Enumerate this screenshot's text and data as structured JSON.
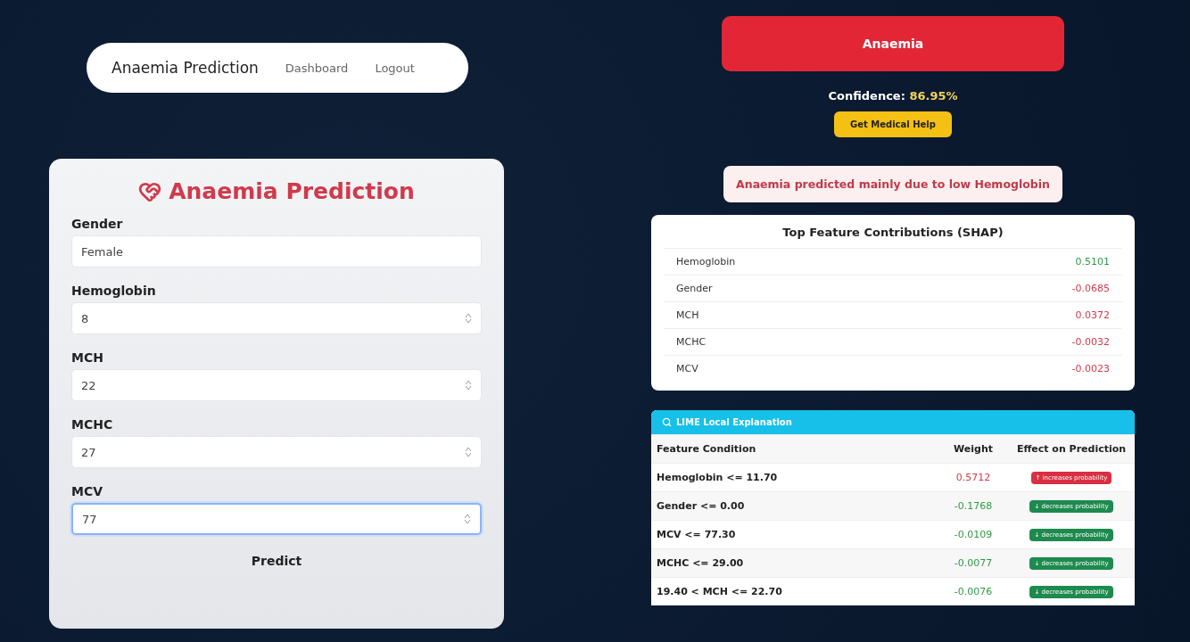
{
  "navbar": {
    "brand": "Anaemia Prediction",
    "links": [
      "Dashboard",
      "Logout"
    ]
  },
  "form": {
    "title": "Anaemia Prediction",
    "fields": [
      {
        "label": "Gender",
        "value": "Female",
        "kind": "text",
        "focused": false
      },
      {
        "label": "Hemoglobin",
        "value": "8",
        "kind": "number",
        "focused": false
      },
      {
        "label": "MCH",
        "value": "22",
        "kind": "number",
        "focused": false
      },
      {
        "label": "MCHC",
        "value": "27",
        "kind": "number",
        "focused": false
      },
      {
        "label": "MCV",
        "value": "77",
        "kind": "number",
        "focused": true
      }
    ],
    "submit": "Predict"
  },
  "result": {
    "label": "Anaemia",
    "confidence_label": "Confidence:",
    "confidence_value": "86.95%",
    "help_button": "Get Medical Help",
    "reason": "Anaemia predicted mainly due to low Hemoglobin"
  },
  "shap": {
    "title": "Top Feature Contributions (SHAP)",
    "rows": [
      {
        "feature": "Hemoglobin",
        "value": "0.5101",
        "kind": "positive"
      },
      {
        "feature": "Gender",
        "value": "-0.0685",
        "kind": "negative"
      },
      {
        "feature": "MCH",
        "value": "0.0372",
        "kind": "negative"
      },
      {
        "feature": "MCHC",
        "value": "-0.0032",
        "kind": "negative"
      },
      {
        "feature": "MCV",
        "value": "-0.0023",
        "kind": "negative"
      }
    ]
  },
  "lime": {
    "title": "LIME Local Explanation",
    "columns": [
      "Feature Condition",
      "Weight",
      "Effect on Prediction"
    ],
    "rows": [
      {
        "condition": "Hemoglobin <= 11.70",
        "weight": "0.5712",
        "effect": "↑ increases probability",
        "kind": "increase"
      },
      {
        "condition": "Gender <= 0.00",
        "weight": "-0.1768",
        "effect": "↓ decreases probability",
        "kind": "decrease"
      },
      {
        "condition": "MCV <= 77.30",
        "weight": "-0.0109",
        "effect": "↓ decreases probability",
        "kind": "decrease"
      },
      {
        "condition": "MCHC <= 29.00",
        "weight": "-0.0077",
        "effect": "↓ decreases probability",
        "kind": "decrease"
      },
      {
        "condition": "19.40 < MCH <= 22.70",
        "weight": "-0.0076",
        "effect": "↓ decreases probability",
        "kind": "decrease"
      }
    ]
  }
}
